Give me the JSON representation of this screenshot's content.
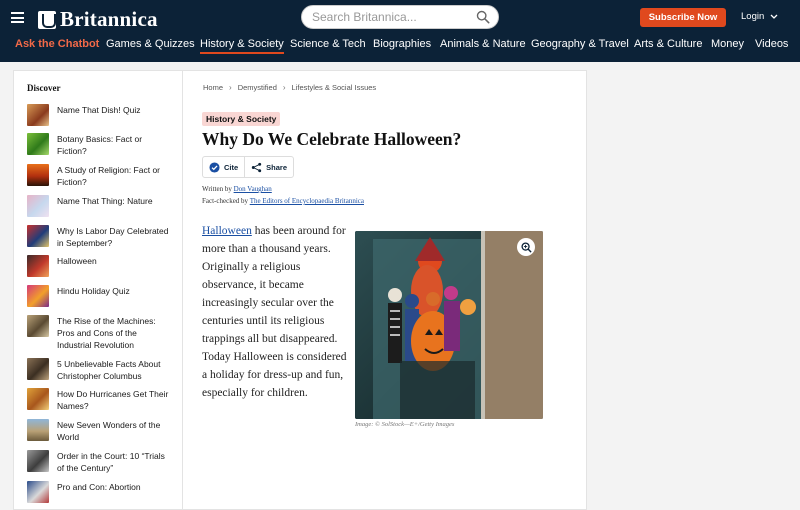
{
  "header": {
    "logo_text": "Britannica",
    "search_placeholder": "Search Britannica...",
    "subscribe_label": "Subscribe Now",
    "login_label": "Login"
  },
  "nav": {
    "items": [
      "Ask the Chatbot",
      "Games & Quizzes",
      "History & Society",
      "Science & Tech",
      "Biographies",
      "Animals & Nature",
      "Geography & Travel",
      "Arts & Culture",
      "Money",
      "Videos"
    ],
    "active": "History & Society"
  },
  "sidebar": {
    "title": "Discover",
    "items": [
      {
        "label": "Name That Dish! Quiz"
      },
      {
        "label": "Botany Basics: Fact or Fiction?"
      },
      {
        "label": "A Study of Religion: Fact or Fiction?"
      },
      {
        "label": "Name That Thing: Nature"
      },
      {
        "label": "Why Is Labor Day Celebrated in September?"
      },
      {
        "label": "Halloween"
      },
      {
        "label": "Hindu Holiday Quiz"
      },
      {
        "label": "The Rise of the Machines: Pros and Cons of the Industrial Revolution"
      },
      {
        "label": "5 Unbelievable Facts About Christopher Columbus"
      },
      {
        "label": "How Do Hurricanes Get Their Names?"
      },
      {
        "label": "New Seven Wonders of the World"
      },
      {
        "label": "Order in the Court: 10 “Trials of the Century”"
      },
      {
        "label": "Pro and Con: Abortion"
      }
    ]
  },
  "article": {
    "breadcrumb": [
      "Home",
      "Demystified",
      "Lifestyles & Social Issues"
    ],
    "tag": "History & Society",
    "title": "Why Do We Celebrate Halloween?",
    "cite_label": "Cite",
    "share_label": "Share",
    "written_by_label": "Written by",
    "author": "Don Vaughan",
    "fact_checked_label": "Fact-checked by",
    "fact_checker": "The Editors of Encyclopaedia Britannica",
    "body_link": "Halloween",
    "body_text": " has been around for more than a thousand years. Originally a religious observance, it became increasingly secular over the centuries until its religious trappings all but disappeared. Today Halloween is considered a holiday for dress-up and fun, especially for children.",
    "image_caption": "Image: © SolStock—E+/Getty Images"
  },
  "colors": {
    "header_bg": "#0c2237",
    "accent": "#e0491e",
    "chatbot": "#f26948",
    "tag_bg": "#f9d6d3",
    "link": "#1a4fa3"
  }
}
